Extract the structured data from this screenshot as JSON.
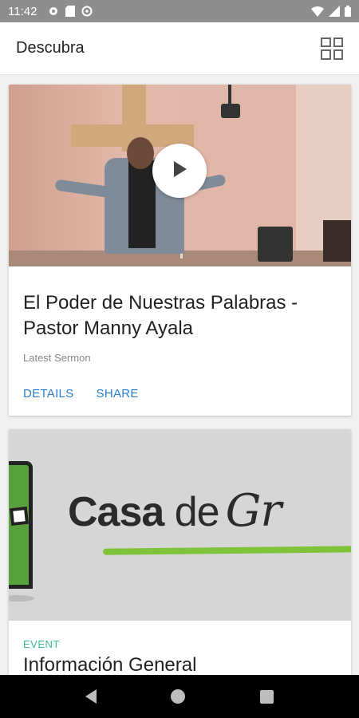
{
  "status_bar": {
    "time": "11:42",
    "left_icons": [
      "gear-icon",
      "sd-card-icon",
      "data-saver-icon"
    ],
    "right_icons": [
      "wifi-icon",
      "signal-icon",
      "battery-icon"
    ]
  },
  "app_bar": {
    "title": "Descubra",
    "layout_toggle_icon": "grid-view-icon"
  },
  "cards": [
    {
      "title": "El Poder de Nuestras Palabras - Pastor Manny Ayala",
      "subtitle": "Latest Sermon",
      "actions": [
        "DETAILS",
        "SHARE"
      ],
      "media_icon": "play-icon"
    },
    {
      "label": "EVENT",
      "title": "Información General",
      "logo": {
        "word1": "Casa",
        "word2": "de",
        "word3": "Gr"
      }
    }
  ],
  "colors": {
    "action": "#2a7fcf",
    "event_label": "#3cc08a",
    "status_bar": "#8e8e8e",
    "logo_green": "#7ec33a"
  },
  "nav_bar": {
    "buttons": [
      "back-icon",
      "home-icon",
      "recents-icon"
    ]
  }
}
